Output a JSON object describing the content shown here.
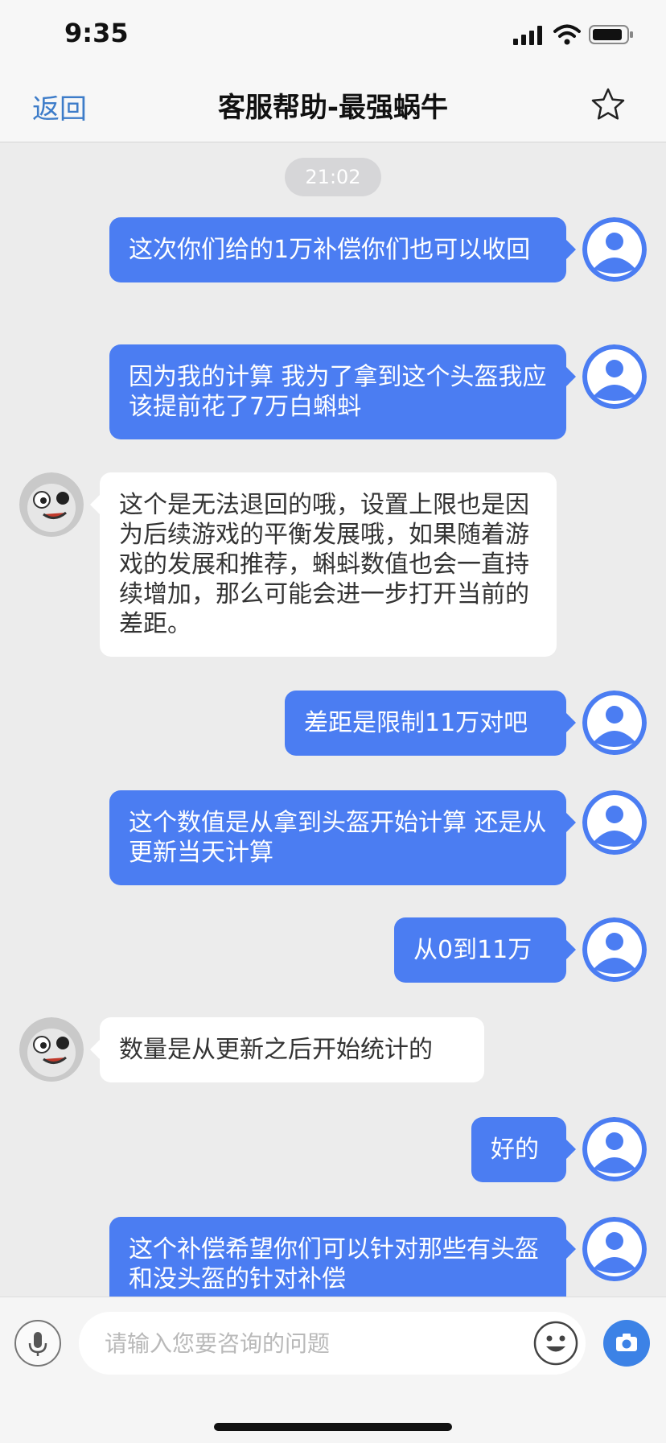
{
  "status_bar": {
    "time": "9:35"
  },
  "nav": {
    "back_label": "返回",
    "title": "客服帮助-最强蜗牛"
  },
  "chat": {
    "timestamp": "21:02",
    "messages": [
      {
        "from": "user",
        "text": "这次你们给的1万补偿你们也可以收回"
      },
      {
        "from": "user",
        "text": "因为我的计算 我为了拿到这个头盔我应该提前花了7万白蝌蚪"
      },
      {
        "from": "agent",
        "text": "这个是无法退回的哦，设置上限也是因为后续游戏的平衡发展哦，如果随着游戏的发展和推荐，蝌蚪数值也会一直持续增加，那么可能会进一步打开当前的差距。"
      },
      {
        "from": "user",
        "text": "差距是限制11万对吧"
      },
      {
        "from": "user",
        "text": "这个数值是从拿到头盔开始计算 还是从更新当天计算"
      },
      {
        "from": "user",
        "text": "从0到11万"
      },
      {
        "from": "agent",
        "text": "数量是从更新之后开始统计的"
      },
      {
        "from": "user",
        "text": "好的"
      },
      {
        "from": "user",
        "text": "这个补偿希望你们可以针对那些有头盔和没头盔的针对补偿"
      }
    ]
  },
  "input": {
    "placeholder": "请输入您要咨询的问题"
  },
  "icons": {
    "back": "back-link",
    "favorite": "star-icon",
    "voice": "microphone-icon",
    "emoji": "emoji-icon",
    "photo": "camera-icon"
  },
  "colors": {
    "outgoing_bubble": "#4b7df2",
    "incoming_bubble": "#ffffff",
    "background": "#ececec",
    "accent": "#3d7cc9",
    "camera_button": "#3c82e6"
  }
}
